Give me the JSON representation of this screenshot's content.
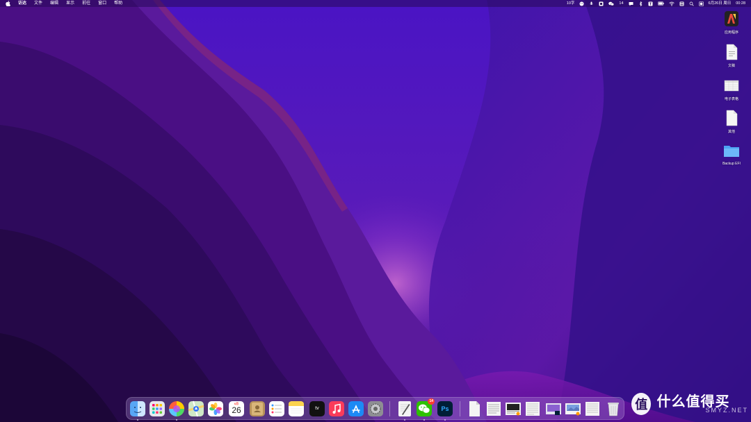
{
  "menubar": {
    "items": [
      "访达",
      "文件",
      "编辑",
      "显示",
      "前往",
      "窗口",
      "帮助"
    ],
    "status": {
      "input_method": "10字",
      "wechat_count": "14",
      "datetime": "6月26日 周日",
      "time": "00:28"
    }
  },
  "desktop": {
    "icons": [
      {
        "label": "应用程序",
        "icon": "app-icon"
      },
      {
        "label": "文稿",
        "icon": "document-icon"
      },
      {
        "label": "电子表格",
        "icon": "spreadsheet-icon"
      },
      {
        "label": "其他",
        "icon": "document-icon"
      },
      {
        "label": "Backup EFI",
        "icon": "folder-icon"
      }
    ]
  },
  "dock": {
    "calendar": {
      "month": "6月",
      "day": "26"
    },
    "tv_label": "tv",
    "wechat_badge": "14",
    "photoshop_label": "Ps",
    "apps": [
      "finder-icon",
      "launchpad-icon",
      "siri-icon",
      "maps-icon",
      "photos-icon",
      "calendar-icon",
      "contacts-icon",
      "reminders-icon",
      "notes-icon",
      "appletv-icon",
      "music-icon",
      "appstore-icon",
      "system-preferences-icon",
      "textedit-icon",
      "wechat-icon",
      "photoshop-icon",
      "document-icon",
      "document-icon",
      "image-icon",
      "document-icon",
      "image-icon",
      "image-icon",
      "document-icon",
      "trash-icon"
    ]
  },
  "watermark": {
    "symbol": "值",
    "main": "什么值得买",
    "sub": "SMYZ.NET"
  },
  "colors": {
    "wallpaper_deep": "#1a0a45",
    "wallpaper_violet": "#4a14c4",
    "wallpaper_magenta": "#8b1fb0",
    "menubar": "#2a0a5a"
  }
}
